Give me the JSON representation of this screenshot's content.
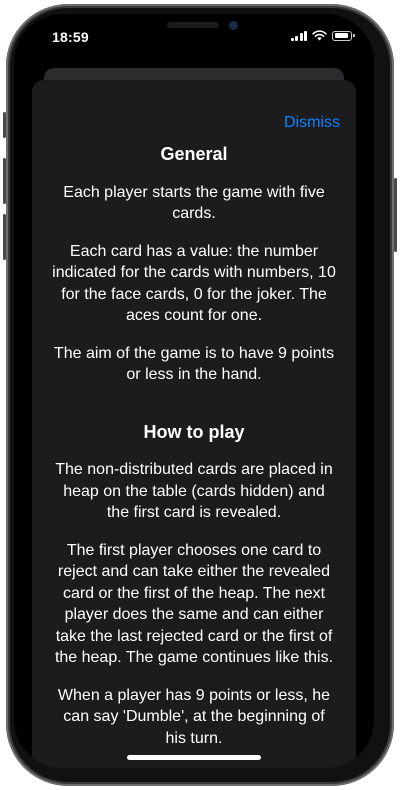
{
  "status_bar": {
    "time": "18:59"
  },
  "sheet": {
    "dismiss_label": "Dismiss",
    "sections": [
      {
        "title": "General",
        "paragraphs": [
          "Each player starts the game with five cards.",
          "Each card has a value: the number indicated for the cards with numbers, 10 for the face cards, 0 for the joker. The aces count for one.",
          "The aim of the game is to have 9 points or less in the hand."
        ]
      },
      {
        "title": "How to play",
        "paragraphs": [
          "The non-distributed cards are placed in heap on the table (cards hidden) and the first card is revealed.",
          "The first player chooses one card to reject and can take either the revealed card or the first of the heap. The next player does the same and can either take the last rejected card or the first of the heap. The game continues like this.",
          "When a player has 9 points or less, he can say 'Dumble', at the beginning of his turn."
        ]
      }
    ]
  },
  "colors": {
    "accent": "#0a84ff",
    "sheet_background": "#1c1c1e",
    "text": "#ffffff"
  }
}
